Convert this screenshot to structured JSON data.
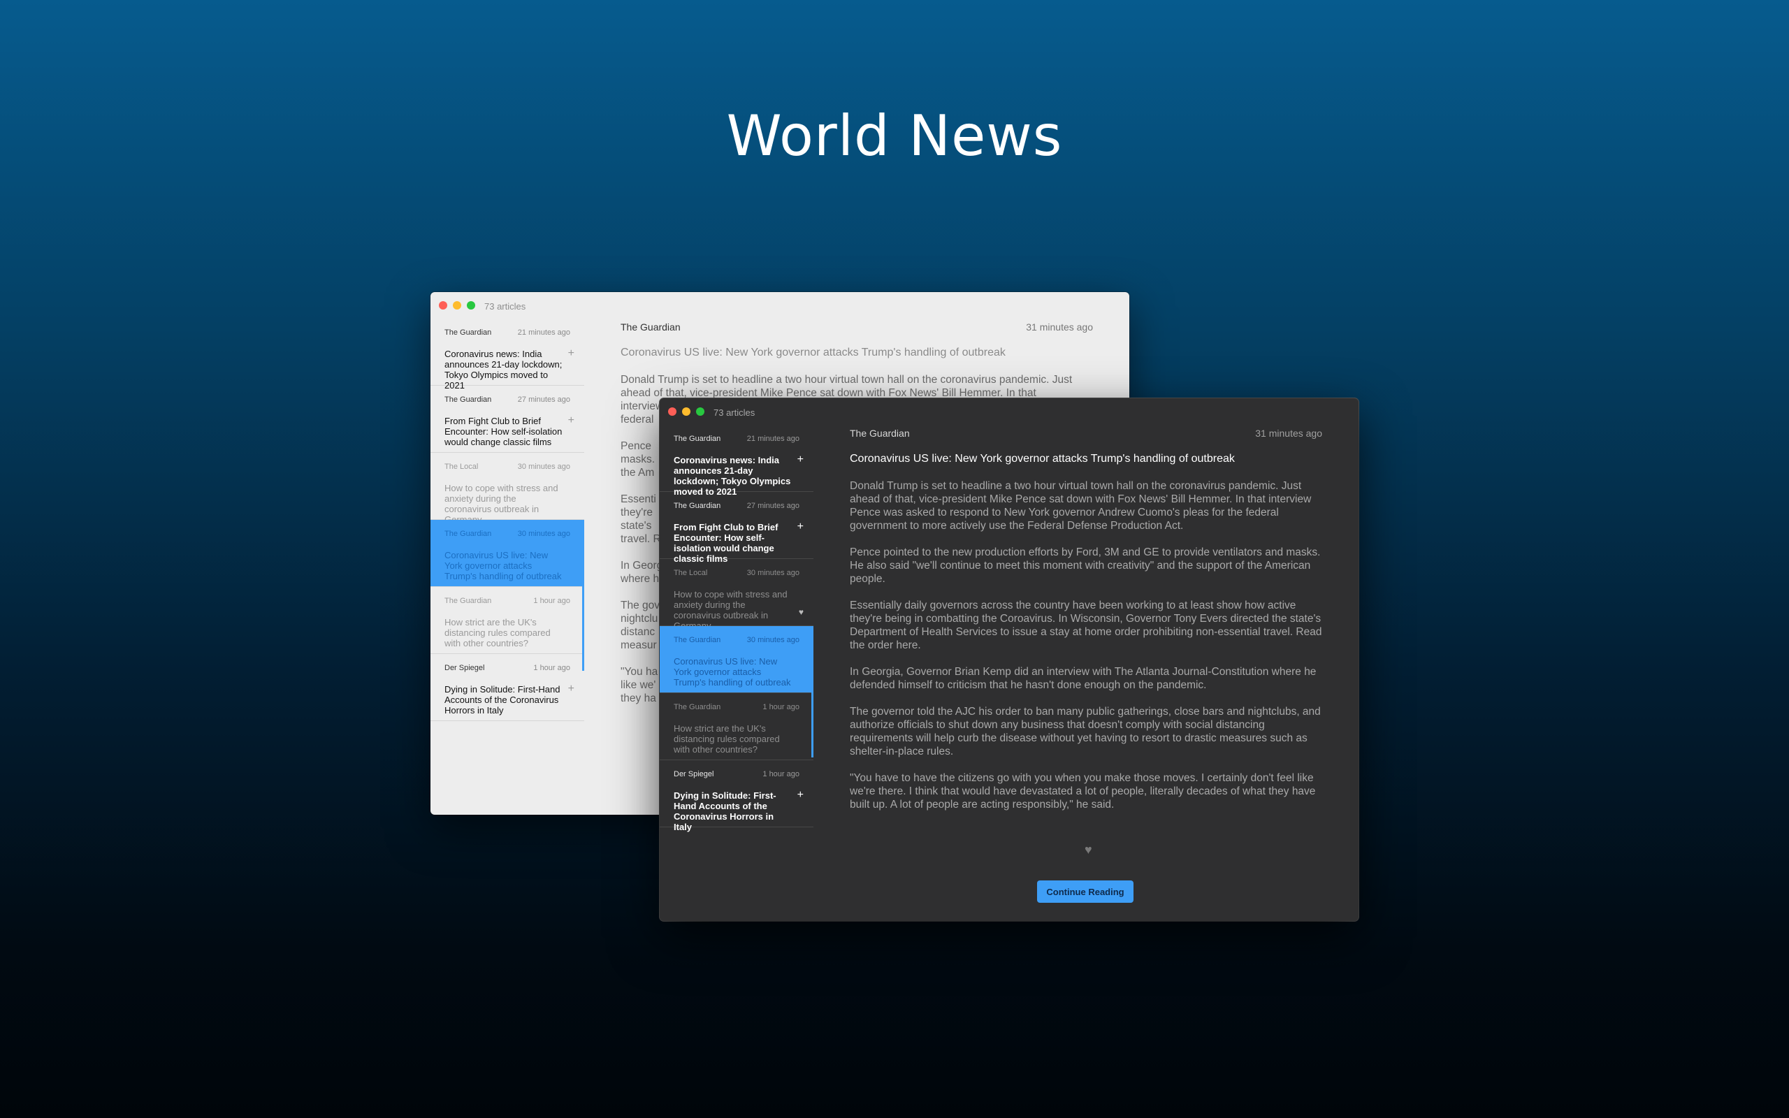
{
  "page": {
    "title": "World News"
  },
  "theme": {
    "accent": "#3e9ef6",
    "dark_bg": "#2f2f30",
    "light_bg": "#ededed"
  },
  "icons": {
    "add": "plus-icon",
    "favorite": "heart-icon"
  },
  "windows": {
    "light": {
      "article_count": "73 articles",
      "articles": [
        {
          "source": "The Guardian",
          "time": "21 minutes ago",
          "title": "Coronavirus news: India announces 21-day lockdown; Tokyo Olympics moved to 2021",
          "mark": "+"
        },
        {
          "source": "The Guardian",
          "time": "27 minutes ago",
          "title": "From Fight Club to Brief Encounter: How self-isolation would change classic films",
          "mark": "+"
        },
        {
          "source": "The Local",
          "time": "30 minutes ago",
          "title": "How to cope with stress and anxiety during the coronavirus outbreak in Germany",
          "mark": ""
        },
        {
          "source": "The Guardian",
          "time": "30 minutes ago",
          "title": "Coronavirus US live: New York governor attacks Trump's handling of outbreak",
          "mark": ""
        },
        {
          "source": "The Guardian",
          "time": "1 hour ago",
          "title": "How strict are the UK's distancing rules compared with other countries?",
          "mark": ""
        },
        {
          "source": "Der Spiegel",
          "time": "1 hour ago",
          "title": "Dying in Solitude: First-Hand Accounts of the Coronavirus Horrors in Italy",
          "mark": "+"
        }
      ],
      "detail": {
        "source": "The Guardian",
        "time": "31 minutes ago",
        "title": "Coronavirus US live: New York governor attacks Trump's handling of outbreak",
        "paragraphs": [
          "Donald Trump is set to headline a two hour virtual town hall on the coronavirus pandemic. Just ahead of that, vice-president Mike Pence sat down with Fox News' Bill Hemmer. In that interview Pence was asked to respond to New York governor Andrew Cuomo's pleas for the federal",
          "Pence",
          "masks.",
          "the Am",
          "Essenti",
          "they're",
          "state's",
          "travel. R",
          "In Georg",
          "where h",
          "The gov",
          "nightclu",
          "distanc",
          "measur",
          "\"You ha",
          "like we'",
          "they ha"
        ]
      }
    },
    "dark": {
      "article_count": "73 articles",
      "articles": [
        {
          "source": "The Guardian",
          "time": "21 minutes ago",
          "title": "Coronavirus news: India announces 21-day lockdown; Tokyo Olympics moved to 2021",
          "mark": "+"
        },
        {
          "source": "The Guardian",
          "time": "27 minutes ago",
          "title": "From Fight Club to Brief Encounter: How self-isolation would change classic films",
          "mark": "+"
        },
        {
          "source": "The Local",
          "time": "30 minutes ago",
          "title": "How to cope with stress and anxiety during the coronavirus outbreak in Germany",
          "mark": "♥"
        },
        {
          "source": "The Guardian",
          "time": "30 minutes ago",
          "title": "Coronavirus US live: New York governor attacks Trump's handling of outbreak",
          "mark": ""
        },
        {
          "source": "The Guardian",
          "time": "1 hour ago",
          "title": "How strict are the UK's distancing rules compared with other countries?",
          "mark": ""
        },
        {
          "source": "Der Spiegel",
          "time": "1 hour ago",
          "title": "Dying in Solitude: First-Hand Accounts of the Coronavirus Horrors in Italy",
          "mark": "+"
        }
      ],
      "detail": {
        "source": "The Guardian",
        "time": "31 minutes ago",
        "title": "Coronavirus US live: New York governor attacks Trump's handling of outbreak",
        "paragraphs": [
          "Donald Trump is set to headline a two hour virtual town hall on the coronavirus pandemic. Just ahead of that, vice-president Mike Pence sat down with Fox News' Bill Hemmer. In that interview Pence was asked to respond to New York governor Andrew Cuomo's pleas for the federal government to more actively use the Federal Defense Production Act.",
          "Pence pointed to the new production efforts by Ford, 3M and GE to provide ventilators and masks. He also said \"we'll continue to meet this moment with creativity\" and the support of the American people.",
          "Essentially daily governors across the country have been working to at least show how active they're being in combatting the Coroavirus. In Wisconsin, Governor Tony Evers directed the state's Department of Health Services to issue a stay at home order prohibiting non-essential travel. Read the order here.",
          "In Georgia, Governor Brian Kemp did an interview with The Atlanta Journal-Constitution where he defended himself to criticism that he hasn't done enough on the pandemic.",
          "The governor told the AJC his order to ban many public gatherings, close bars and nightclubs, and authorize officials to shut down any business that doesn't comply with social distancing requirements will help curb the disease without yet having to resort to drastic measures such as shelter-in-place rules.",
          "\"You have to have the citizens go with you when you make those moves. I certainly don't feel like we're there. I think that would have devastated a lot of people, literally decades of what they have built up. A lot of people are acting responsibly,\" he said."
        ],
        "heart": "♥",
        "continue_label": "Continue Reading"
      }
    }
  }
}
